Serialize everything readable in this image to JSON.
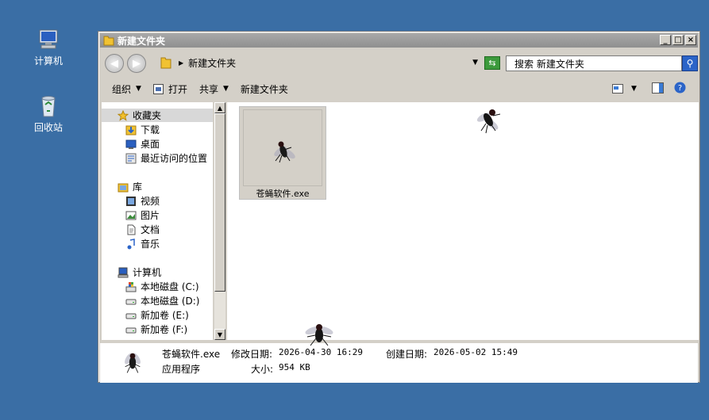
{
  "desktop": {
    "icons": [
      {
        "label": "计算机",
        "icon": "computer-icon"
      },
      {
        "label": "回收站",
        "icon": "recycle-bin-icon"
      }
    ]
  },
  "window": {
    "title": "新建文件夹",
    "controls": {
      "minimize": "_",
      "maximize": "□",
      "close": "×"
    }
  },
  "address": {
    "path": "新建文件夹",
    "search_placeholder": "搜索 新建文件夹"
  },
  "toolbar": {
    "organize": "组织",
    "open": "打开",
    "share": "共享",
    "new_folder": "新建文件夹"
  },
  "nav": {
    "favorites": {
      "label": "收藏夹",
      "items": [
        "下载",
        "桌面",
        "最近访问的位置"
      ]
    },
    "library": {
      "label": "库",
      "items": [
        "视频",
        "图片",
        "文档",
        "音乐"
      ]
    },
    "computer": {
      "label": "计算机",
      "items": [
        "本地磁盘 (C:)",
        "本地磁盘 (D:)",
        "新加卷 (E:)",
        "新加卷 (F:)"
      ]
    }
  },
  "files": [
    {
      "name": "苍蝇软件.exe",
      "icon": "fly-icon"
    }
  ],
  "details": {
    "name": "苍蝇软件.exe",
    "type": "应用程序",
    "modified_label": "修改日期:",
    "modified": "2026-04-30 16:29",
    "created_label": "创建日期:",
    "created": "2026-05-02 15:49",
    "size_label": "大小:",
    "size": "954 KB"
  },
  "colors": {
    "desktop_bg": "#3a6ea5",
    "window_bg": "#d4d0c8",
    "titlebar": "#9a9a9a"
  }
}
